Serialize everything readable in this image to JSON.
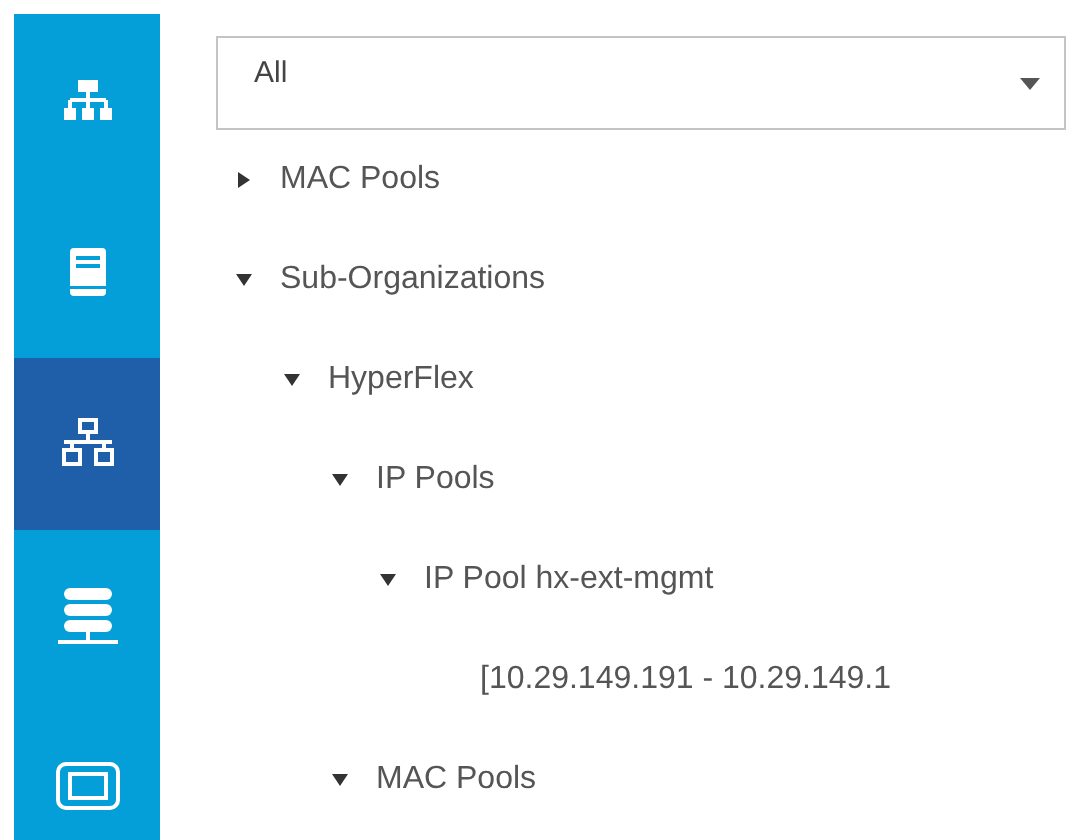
{
  "sidebar": {
    "items": [
      {
        "selected": false
      },
      {
        "selected": false
      },
      {
        "selected": true
      },
      {
        "selected": false
      },
      {
        "selected": false
      }
    ]
  },
  "filter": {
    "value": "All"
  },
  "tree": [
    {
      "label": "MAC Pools",
      "expanded": false
    },
    {
      "label": "Sub-Organizations",
      "expanded": true,
      "children": [
        {
          "label": "HyperFlex",
          "expanded": true,
          "children": [
            {
              "label": "IP Pools",
              "expanded": true,
              "children": [
                {
                  "label": "IP Pool hx-ext-mgmt",
                  "expanded": true,
                  "children": [
                    {
                      "label": "[10.29.149.191 - 10.29.149.1"
                    }
                  ]
                }
              ]
            },
            {
              "label": "MAC Pools",
              "expanded": true
            }
          ]
        }
      ]
    }
  ]
}
